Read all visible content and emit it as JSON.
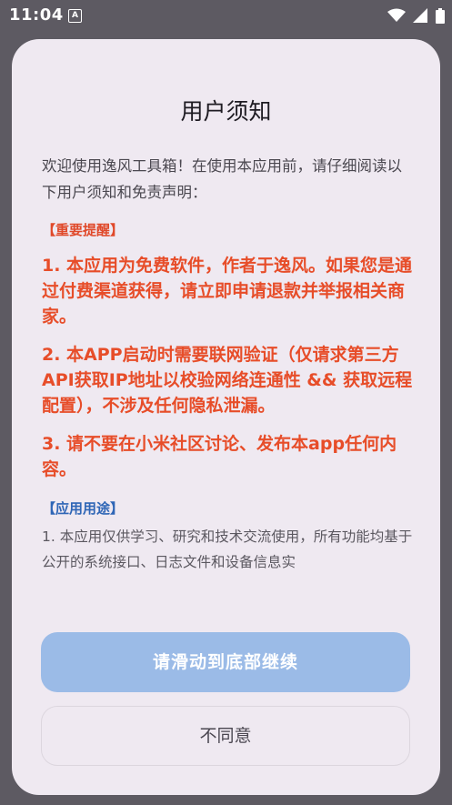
{
  "status_bar": {
    "time": "11:04",
    "notification_icon": "A"
  },
  "dialog": {
    "title": "用户须知",
    "intro": "欢迎使用逸风工具箱！在使用本应用前，请仔细阅读以下用户须知和免责声明：",
    "important_heading": "【重要提醒】",
    "important_items": [
      "1. 本应用为免费软件，作者于逸风。如果您是通过付费渠道获得，请立即申请退款并举报相关商家。",
      "2. 本APP启动时需要联网验证（仅请求第三方API获取IP地址以校验网络连通性 && 获取远程配置），不涉及任何隐私泄漏。",
      "3. 请不要在小米社区讨论、发布本app任何内容。"
    ],
    "usage_heading": "【应用用途】",
    "usage_items": [
      "1. 本应用仅供学习、研究和技术交流使用，所有功能均基于公开的系统接口、日志文件和设备信息实"
    ],
    "continue_button": "请滑动到底部继续",
    "disagree_button": "不同意"
  },
  "colors": {
    "scrim": "#5d5a62",
    "dialog_bg": "#efe9f1",
    "important_red": "#e74d29",
    "usage_blue": "#2f66b6",
    "primary_button_disabled": "#9bbbe7"
  }
}
